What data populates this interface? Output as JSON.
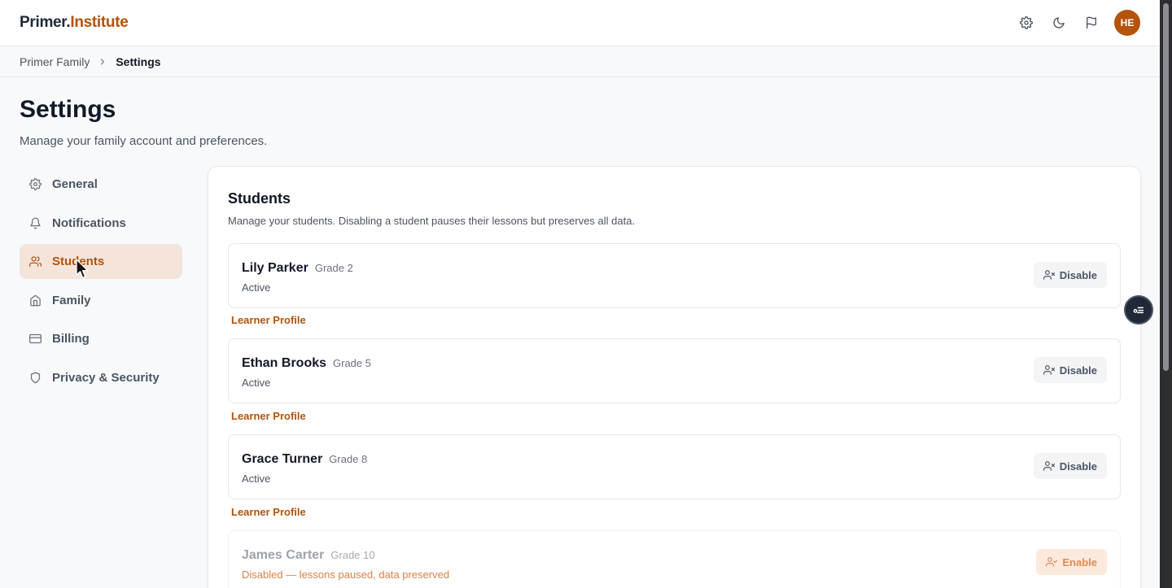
{
  "header": {
    "logo_part1": "Primer.",
    "logo_part2": "Institute",
    "avatar_initials": "HE",
    "icons": [
      "gear-icon",
      "moon-icon",
      "flag-icon"
    ]
  },
  "breadcrumb": {
    "parent": "Primer Family",
    "current": "Settings"
  },
  "page": {
    "title": "Settings",
    "subtitle": "Manage your family account and preferences."
  },
  "sidebar": {
    "items": [
      {
        "label": "General",
        "icon": "gear-icon"
      },
      {
        "label": "Notifications",
        "icon": "bell-icon"
      },
      {
        "label": "Students",
        "icon": "users-icon",
        "active": true
      },
      {
        "label": "Family",
        "icon": "home-icon"
      },
      {
        "label": "Billing",
        "icon": "credit-card-icon"
      },
      {
        "label": "Privacy & Security",
        "icon": "shield-icon"
      }
    ]
  },
  "students_panel": {
    "title": "Students",
    "description": "Manage your students. Disabling a student pauses their lessons but preserves all data.",
    "learner_profile_label": "Learner Profile",
    "students": [
      {
        "name": "Lily Parker",
        "grade": "Grade 2",
        "status": "Active",
        "action": "Disable"
      },
      {
        "name": "Ethan Brooks",
        "grade": "Grade 5",
        "status": "Active",
        "action": "Disable"
      },
      {
        "name": "Grace Turner",
        "grade": "Grade 8",
        "status": "Active",
        "action": "Disable"
      },
      {
        "name": "James Carter",
        "grade": "Grade 10",
        "status": "Disabled — lessons paused, data preserved",
        "action": "Enable"
      }
    ]
  },
  "colors": {
    "accent": "#b45309",
    "active_nav_bg": "#f4e4da",
    "enable_bg": "#fbe9dd"
  }
}
